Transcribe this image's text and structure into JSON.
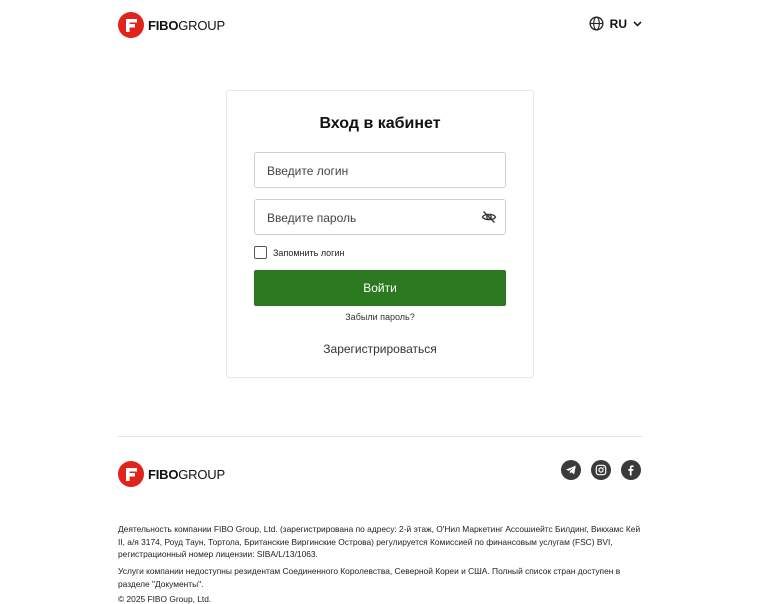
{
  "header": {
    "logo": {
      "brand_bold": "FIBO",
      "brand_light": "GROUP"
    },
    "language": {
      "code": "RU"
    }
  },
  "login": {
    "title": "Вход в кабинет",
    "login_placeholder": "Введите логин",
    "password_placeholder": "Введите пароль",
    "remember_label": "Запомнить логин",
    "submit_label": "Войти",
    "forgot_label": "Забыли пароль?",
    "register_label": "Зарегистрироваться"
  },
  "footer": {
    "logo": {
      "brand_bold": "FIBO",
      "brand_light": "GROUP"
    },
    "socials": [
      "telegram-icon",
      "instagram-icon",
      "facebook-icon"
    ],
    "legal_text_1": "Деятельность компании FIBO Group, Ltd. (зарегистрирована по адресу: 2-й этаж, О'Нил Маркетинг Ассошиейтс Билдинг, Викхамс Кей II, а/я 3174, Роуд Таун, Тортола, Британские Виргинские Острова) регулируется Комиссией по финансовым услугам (FSC) BVI, регистрационный номер лицензии: SIBA/L/13/1063.",
    "legal_text_2": "Услуги компании недоступны резидентам Соединенного Королевства, Северной Кореи и США. Полный список стран доступен в разделе \"Документы\".",
    "copyright": "© 2025 FIBO Group, Ltd."
  },
  "colors": {
    "brand_red": "#e0231b",
    "primary_green": "#2b7a1f",
    "social_bg": "#3a3a3a"
  }
}
